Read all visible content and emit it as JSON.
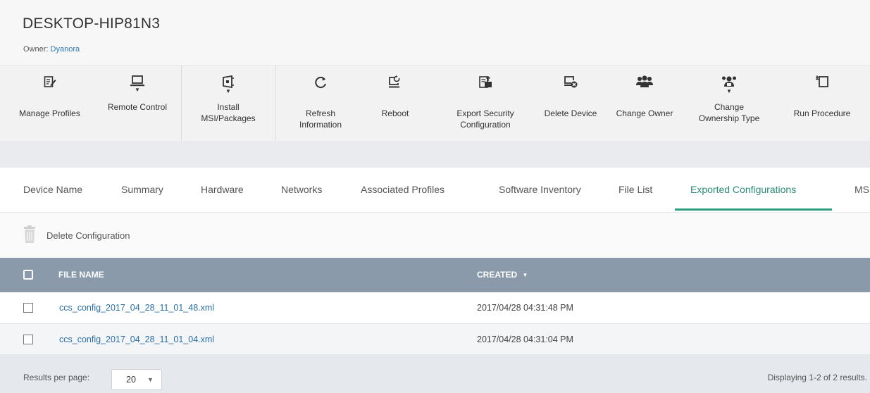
{
  "device": {
    "name": "DESKTOP-HIP81N3",
    "owner_label": "Owner:",
    "owner_name": "Dyanora"
  },
  "toolbar": [
    {
      "label": "Manage Profiles",
      "icon": "manage-profiles-icon"
    },
    {
      "label": "Remote Control",
      "icon": "monitor-icon",
      "dropdown": true
    },
    {
      "label": "Install\nMSI/Packages",
      "icon": "install-package-icon",
      "dropdown": true
    },
    {
      "label": "Refresh\nInformation",
      "icon": "refresh-icon"
    },
    {
      "label": "Reboot",
      "icon": "reboot-icon"
    },
    {
      "label": "Export Security\nConfiguration",
      "icon": "export-config-icon"
    },
    {
      "label": "Delete Device",
      "icon": "delete-device-icon"
    },
    {
      "label": "Change Owner",
      "icon": "users-icon"
    },
    {
      "label": "Change\nOwnership Type",
      "icon": "ownership-type-icon",
      "dropdown": true
    },
    {
      "label": "Run Procedure",
      "icon": "run-procedure-icon"
    }
  ],
  "tabs": [
    {
      "label": "Device Name"
    },
    {
      "label": "Summary"
    },
    {
      "label": "Hardware"
    },
    {
      "label": "Networks"
    },
    {
      "label": "Associated Profiles"
    },
    {
      "label": "Software Inventory"
    },
    {
      "label": "File List"
    },
    {
      "label": "Exported Configurations",
      "active": true
    },
    {
      "label": "MSI"
    }
  ],
  "actions": {
    "delete_configuration": "Delete Configuration"
  },
  "table": {
    "columns": {
      "file_name": "FILE NAME",
      "created": "CREATED"
    },
    "rows": [
      {
        "file_name": "ccs_config_2017_04_28_11_01_48.xml",
        "created": "2017/04/28 04:31:48 PM"
      },
      {
        "file_name": "ccs_config_2017_04_28_11_01_04.xml",
        "created": "2017/04/28 04:31:04 PM"
      }
    ]
  },
  "footer": {
    "results_per_page_label": "Results per page:",
    "results_per_page_value": "20",
    "results_text": "Displaying 1-2 of 2 results."
  },
  "colors": {
    "accent": "#2aa07e",
    "link": "#2a6ea8",
    "table_header": "#8a9aab"
  }
}
